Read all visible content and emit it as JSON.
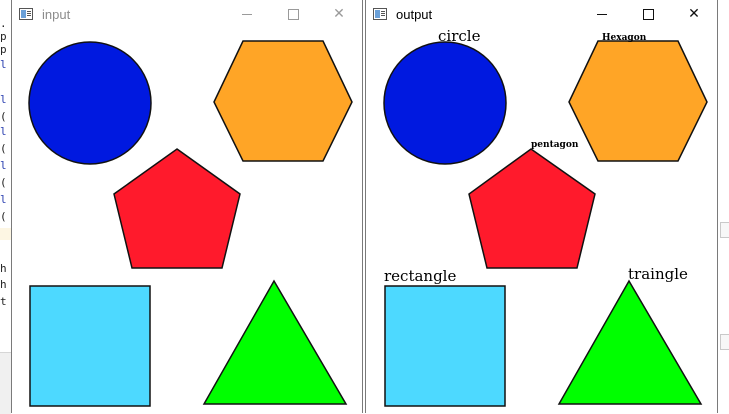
{
  "background_editor": {
    "fragments": [
      ".",
      "p",
      "p",
      "l",
      "l",
      "(",
      "l",
      "(",
      "l",
      "(",
      "l",
      "(",
      "h",
      "h",
      "t",
      "p"
    ]
  },
  "windows": {
    "input": {
      "title": "input"
    },
    "output": {
      "title": "output",
      "labels": {
        "circle": "circle",
        "hexagon": "Hexagon",
        "pentagon": "pentagon",
        "rectangle": "rectangle",
        "triangle": "traingle"
      }
    }
  },
  "shape_colors": {
    "circle": "#0019e0",
    "hexagon": "#ffa526",
    "pentagon": "#ff1a2c",
    "rectangle": "#4dd9ff",
    "triangle": "#00ff00",
    "outline": "#111111"
  },
  "window_controls": {
    "minimize": "minimize-icon",
    "maximize": "maximize-icon",
    "close": "close-icon"
  }
}
